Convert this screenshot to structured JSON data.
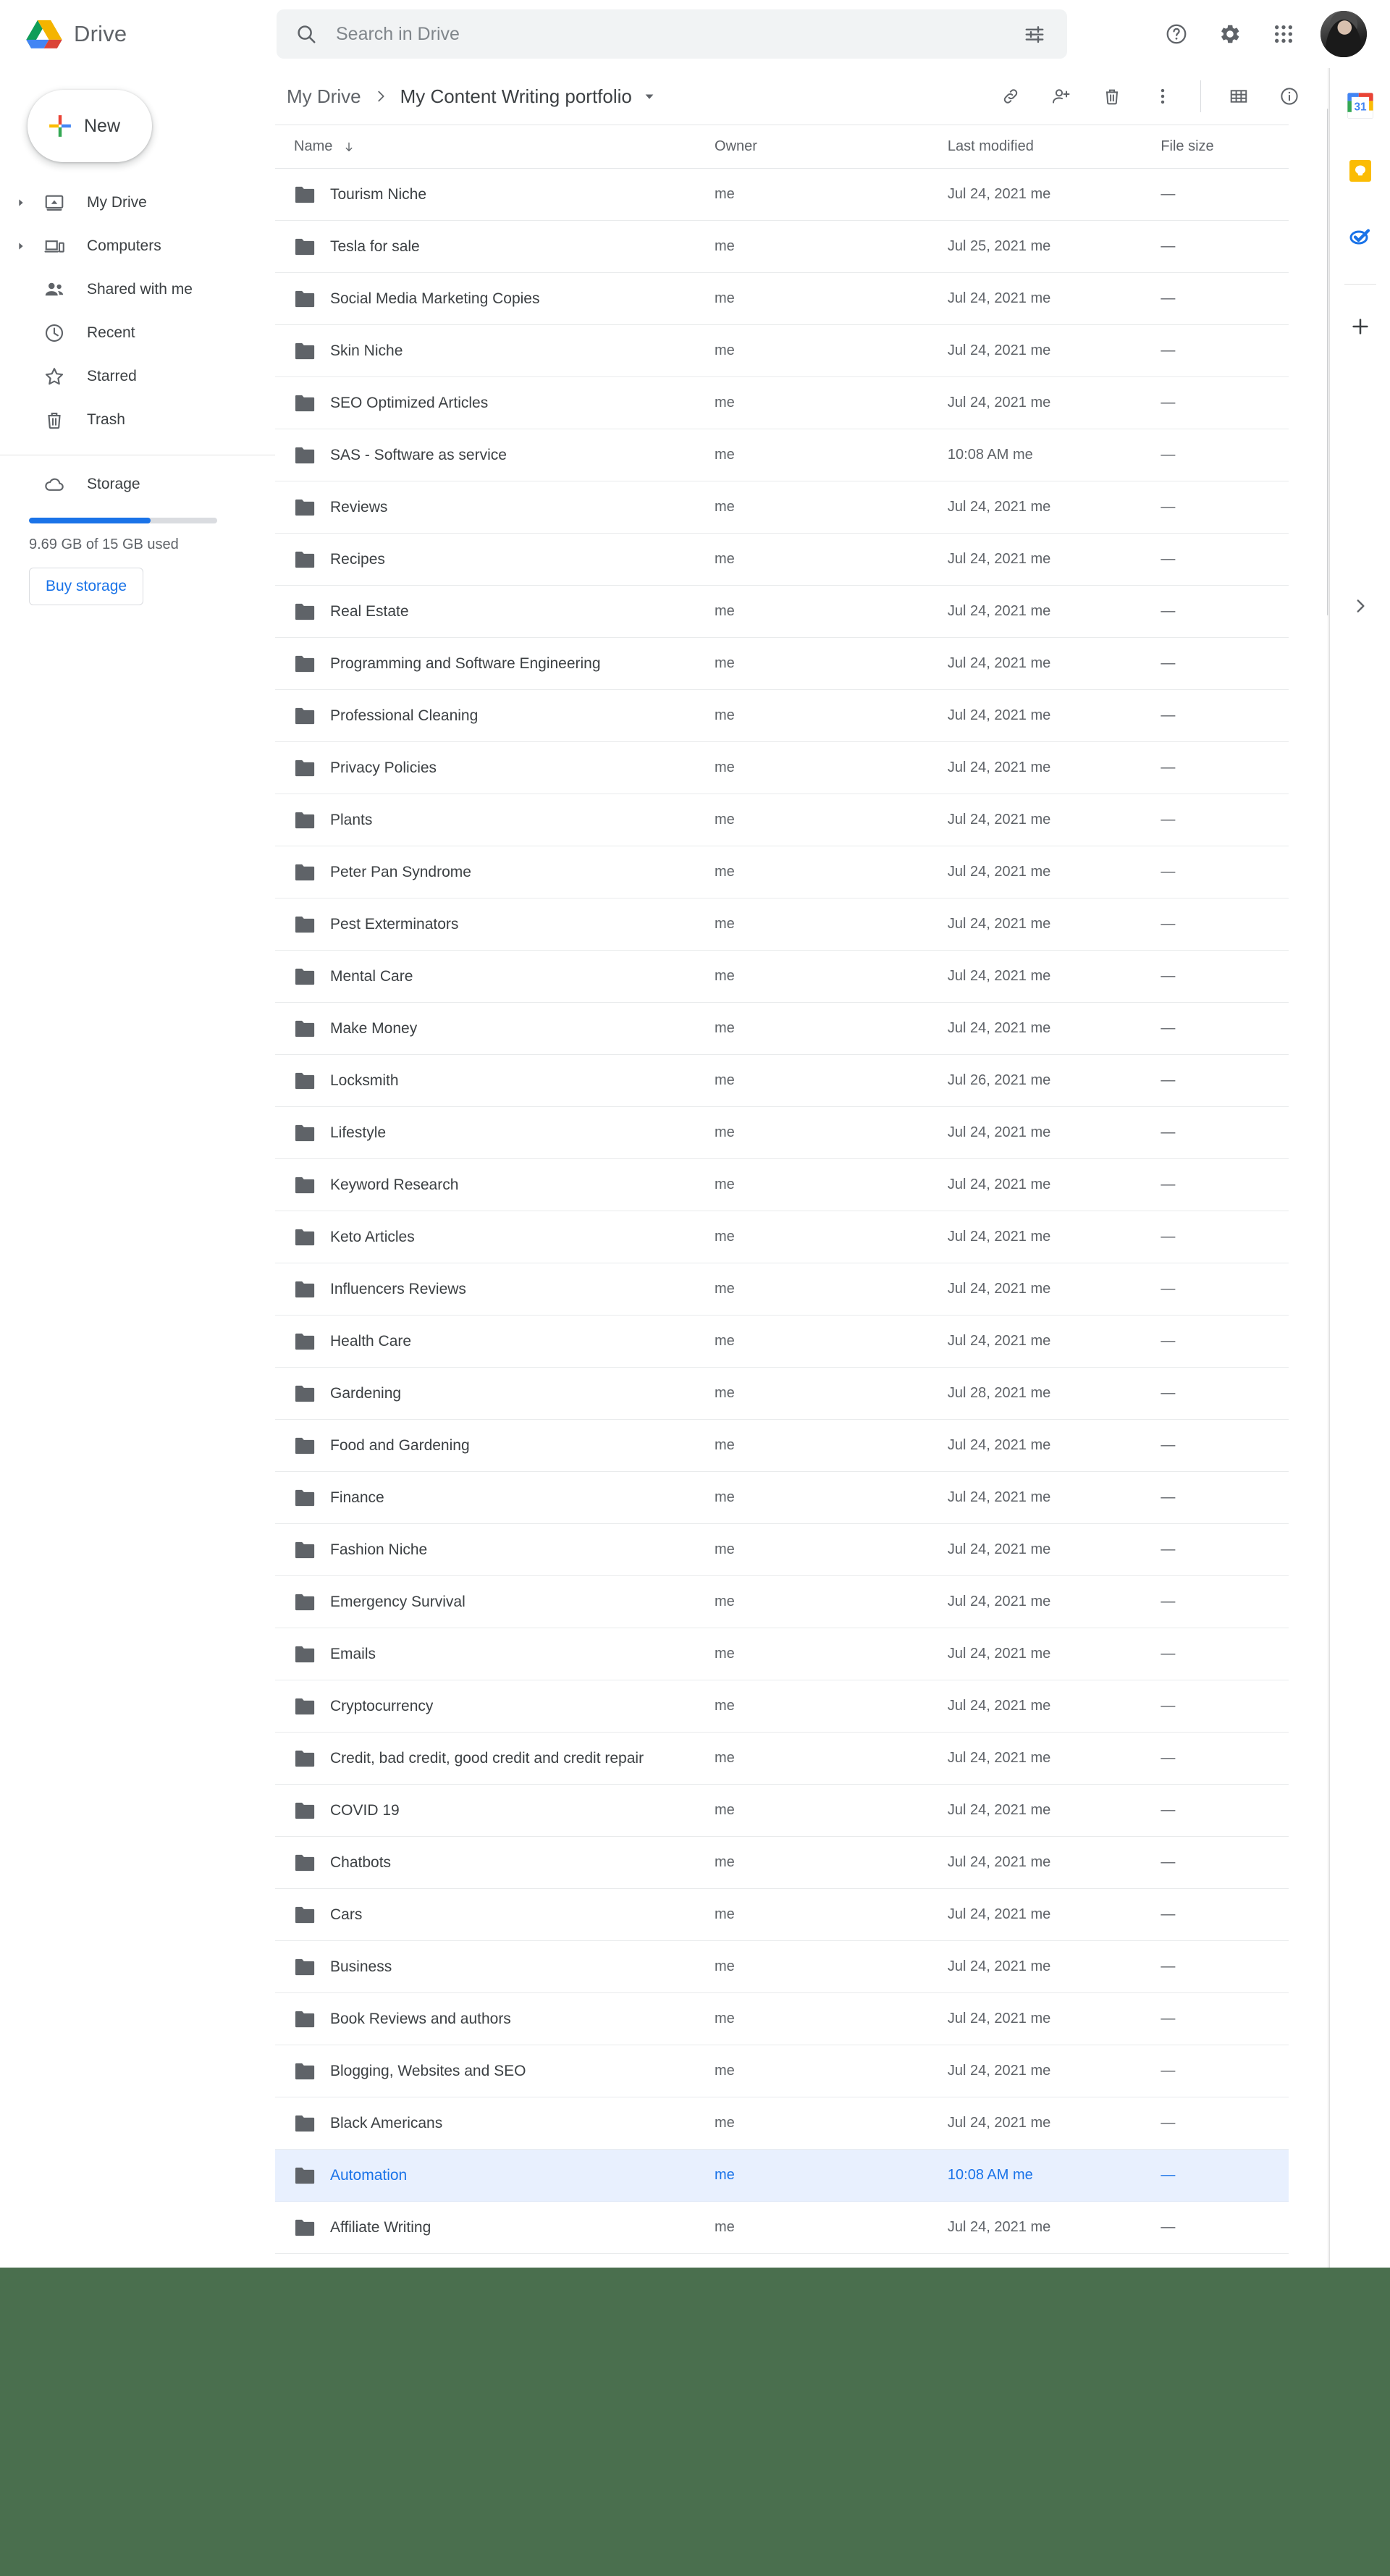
{
  "app": {
    "brand_name": "Drive",
    "logo_icon": "drive-logo-icon"
  },
  "search": {
    "placeholder": "Search in Drive",
    "value": "",
    "search_icon": "search-icon",
    "tune_icon": "tune-icon"
  },
  "top_actions": {
    "help_icon": "help-icon",
    "settings_icon": "gear-icon",
    "apps_icon": "apps-grid-icon",
    "avatar_icon": "avatar"
  },
  "sidebar": {
    "new_button": "New",
    "new_icon": "plus-colored-icon",
    "items": [
      {
        "label": "My Drive",
        "icon": "my-drive-icon",
        "expandable": true
      },
      {
        "label": "Computers",
        "icon": "computers-icon",
        "expandable": true
      },
      {
        "label": "Shared with me",
        "icon": "shared-with-me-icon",
        "expandable": false
      },
      {
        "label": "Recent",
        "icon": "clock-icon",
        "expandable": false
      },
      {
        "label": "Starred",
        "icon": "star-icon",
        "expandable": false
      },
      {
        "label": "Trash",
        "icon": "trash-icon",
        "expandable": false
      }
    ],
    "storage": {
      "label": "Storage",
      "icon": "cloud-icon",
      "usage_text": "9.69 GB of 15 GB used",
      "used_percent": 64.6,
      "buy_label": "Buy storage",
      "bar_color": "#1a73e8"
    }
  },
  "breadcrumb": {
    "root": "My Drive",
    "separator": "›",
    "current": "My Content Writing portfolio",
    "caret_icon": "chevron-down-icon"
  },
  "toolbar": {
    "link_icon": "link-icon",
    "add_person_icon": "add-person-icon",
    "trash_icon": "trash-icon",
    "more_icon": "more-vertical-icon",
    "grid_view_icon": "grid-view-icon",
    "details_icon": "info-icon"
  },
  "table": {
    "columns": [
      "Name",
      "Owner",
      "Last modified",
      "File size"
    ],
    "sort_column": "Name",
    "sort_direction": "down",
    "sort_icon": "arrow-down-icon",
    "rows": [
      {
        "name": "Tourism Niche",
        "owner": "me",
        "modified": "Jul 24, 2021 me",
        "size": "—",
        "selected": false
      },
      {
        "name": "Tesla for sale",
        "owner": "me",
        "modified": "Jul 25, 2021 me",
        "size": "—",
        "selected": false
      },
      {
        "name": "Social Media Marketing Copies",
        "owner": "me",
        "modified": "Jul 24, 2021 me",
        "size": "—",
        "selected": false
      },
      {
        "name": "Skin Niche",
        "owner": "me",
        "modified": "Jul 24, 2021 me",
        "size": "—",
        "selected": false
      },
      {
        "name": "SEO Optimized Articles",
        "owner": "me",
        "modified": "Jul 24, 2021 me",
        "size": "—",
        "selected": false
      },
      {
        "name": "SAS - Software as service",
        "owner": "me",
        "modified": "10:08 AM me",
        "size": "—",
        "selected": false
      },
      {
        "name": "Reviews",
        "owner": "me",
        "modified": "Jul 24, 2021 me",
        "size": "—",
        "selected": false
      },
      {
        "name": "Recipes",
        "owner": "me",
        "modified": "Jul 24, 2021 me",
        "size": "—",
        "selected": false
      },
      {
        "name": "Real Estate",
        "owner": "me",
        "modified": "Jul 24, 2021 me",
        "size": "—",
        "selected": false
      },
      {
        "name": "Programming and Software Engineering",
        "owner": "me",
        "modified": "Jul 24, 2021 me",
        "size": "—",
        "selected": false
      },
      {
        "name": "Professional Cleaning",
        "owner": "me",
        "modified": "Jul 24, 2021 me",
        "size": "—",
        "selected": false
      },
      {
        "name": "Privacy Policies",
        "owner": "me",
        "modified": "Jul 24, 2021 me",
        "size": "—",
        "selected": false
      },
      {
        "name": "Plants",
        "owner": "me",
        "modified": "Jul 24, 2021 me",
        "size": "—",
        "selected": false
      },
      {
        "name": "Peter Pan Syndrome",
        "owner": "me",
        "modified": "Jul 24, 2021 me",
        "size": "—",
        "selected": false
      },
      {
        "name": "Pest Exterminators",
        "owner": "me",
        "modified": "Jul 24, 2021 me",
        "size": "—",
        "selected": false
      },
      {
        "name": "Mental Care",
        "owner": "me",
        "modified": "Jul 24, 2021 me",
        "size": "—",
        "selected": false
      },
      {
        "name": "Make Money",
        "owner": "me",
        "modified": "Jul 24, 2021 me",
        "size": "—",
        "selected": false
      },
      {
        "name": "Locksmith",
        "owner": "me",
        "modified": "Jul 26, 2021 me",
        "size": "—",
        "selected": false
      },
      {
        "name": "Lifestyle",
        "owner": "me",
        "modified": "Jul 24, 2021 me",
        "size": "—",
        "selected": false
      },
      {
        "name": "Keyword Research",
        "owner": "me",
        "modified": "Jul 24, 2021 me",
        "size": "—",
        "selected": false
      },
      {
        "name": "Keto Articles",
        "owner": "me",
        "modified": "Jul 24, 2021 me",
        "size": "—",
        "selected": false
      },
      {
        "name": "Influencers Reviews",
        "owner": "me",
        "modified": "Jul 24, 2021 me",
        "size": "—",
        "selected": false
      },
      {
        "name": "Health Care",
        "owner": "me",
        "modified": "Jul 24, 2021 me",
        "size": "—",
        "selected": false
      },
      {
        "name": "Gardening",
        "owner": "me",
        "modified": "Jul 28, 2021 me",
        "size": "—",
        "selected": false
      },
      {
        "name": "Food and Gardening",
        "owner": "me",
        "modified": "Jul 24, 2021 me",
        "size": "—",
        "selected": false
      },
      {
        "name": "Finance",
        "owner": "me",
        "modified": "Jul 24, 2021 me",
        "size": "—",
        "selected": false
      },
      {
        "name": "Fashion Niche",
        "owner": "me",
        "modified": "Jul 24, 2021 me",
        "size": "—",
        "selected": false
      },
      {
        "name": "Emergency Survival",
        "owner": "me",
        "modified": "Jul 24, 2021 me",
        "size": "—",
        "selected": false
      },
      {
        "name": "Emails",
        "owner": "me",
        "modified": "Jul 24, 2021 me",
        "size": "—",
        "selected": false
      },
      {
        "name": "Cryptocurrency",
        "owner": "me",
        "modified": "Jul 24, 2021 me",
        "size": "—",
        "selected": false
      },
      {
        "name": "Credit, bad credit, good credit and credit repair",
        "owner": "me",
        "modified": "Jul 24, 2021 me",
        "size": "—",
        "selected": false
      },
      {
        "name": "COVID 19",
        "owner": "me",
        "modified": "Jul 24, 2021 me",
        "size": "—",
        "selected": false
      },
      {
        "name": "Chatbots",
        "owner": "me",
        "modified": "Jul 24, 2021 me",
        "size": "—",
        "selected": false
      },
      {
        "name": "Cars",
        "owner": "me",
        "modified": "Jul 24, 2021 me",
        "size": "—",
        "selected": false
      },
      {
        "name": "Business",
        "owner": "me",
        "modified": "Jul 24, 2021 me",
        "size": "—",
        "selected": false
      },
      {
        "name": "Book Reviews and authors",
        "owner": "me",
        "modified": "Jul 24, 2021 me",
        "size": "—",
        "selected": false
      },
      {
        "name": "Blogging, Websites and SEO",
        "owner": "me",
        "modified": "Jul 24, 2021 me",
        "size": "—",
        "selected": false
      },
      {
        "name": "Black Americans",
        "owner": "me",
        "modified": "Jul 24, 2021 me",
        "size": "—",
        "selected": false
      },
      {
        "name": "Automation",
        "owner": "me",
        "modified": "10:08 AM me",
        "size": "—",
        "selected": true
      },
      {
        "name": "Affiliate Writing",
        "owner": "me",
        "modified": "Jul 24, 2021 me",
        "size": "—",
        "selected": false
      }
    ]
  },
  "right_panel": {
    "items": [
      {
        "icon": "google-calendar-icon"
      },
      {
        "icon": "google-keep-icon"
      },
      {
        "icon": "google-tasks-icon"
      }
    ],
    "add_icon": "plus-icon",
    "expand_icon": "chevron-right-icon"
  },
  "colors": {
    "accent_blue": "#1a73e8",
    "selected_row": "#e8f0fe",
    "bottom_area_green": "#4a6f4e",
    "text_primary": "#3c4043",
    "text_secondary": "#5f6368"
  }
}
